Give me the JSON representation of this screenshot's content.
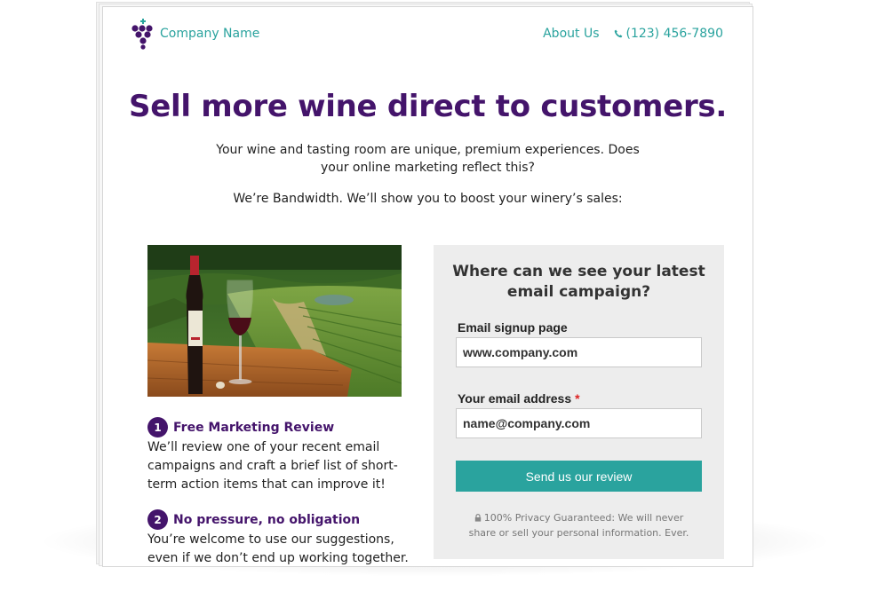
{
  "header": {
    "company_name": "Company Name",
    "logo_icon": "grape-cluster-icon",
    "nav_about": "About Us",
    "phone_icon": "phone-icon",
    "phone": "(123) 456-7890"
  },
  "hero": {
    "headline": "Sell more wine direct to customers.",
    "subtext": "Your wine and tasting room are unique, premium experiences. Does your online marketing reflect this?",
    "intro": "We’re Bandwidth. We’ll show you to boost your winery’s sales:"
  },
  "steps": [
    {
      "number": "1",
      "title": "Free Marketing Review",
      "body": "We’ll review one of your recent email campaigns and craft a brief list of short-term action items that can improve it!"
    },
    {
      "number": "2",
      "title": "No pressure, no obligation",
      "body": "You’re welcome to use our suggestions, even if we don’t end up working together."
    }
  ],
  "form": {
    "question": "Where can we see your latest email campaign?",
    "email_page_label": "Email signup page",
    "email_page_value": "www.company.com",
    "email_address_label": "Your email address",
    "required_mark": "*",
    "email_address_value": "name@company.com",
    "submit_label": "Send us our review",
    "lock_icon": "lock-icon",
    "privacy_note": "100% Privacy Guaranteed: We will never share or sell your personal information. Ever."
  },
  "colors": {
    "brand_purple": "#44146b",
    "accent_teal": "#2aa39e",
    "form_background": "#ededed"
  }
}
